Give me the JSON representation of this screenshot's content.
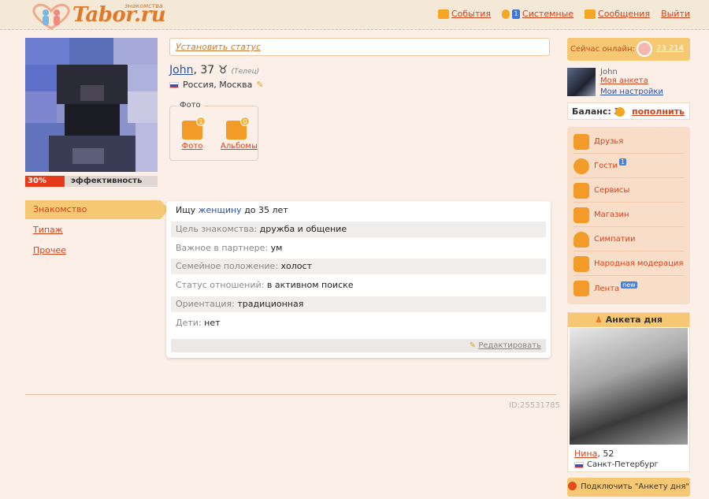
{
  "header": {
    "brand": "Tabor.ru",
    "brand_small": "знакомства",
    "nav": [
      {
        "label": "События",
        "icon": "bell-icon"
      },
      {
        "label": "Системные",
        "icon": "info-icon",
        "badge": "1"
      },
      {
        "label": "Сообщения",
        "icon": "envelope-icon"
      },
      {
        "label": "Выйти",
        "icon": ""
      }
    ]
  },
  "profile": {
    "status_placeholder": "Установить статус",
    "name": "John",
    "age": ", 37 ",
    "zodiac_symbol": "♉",
    "zodiac": "(Телец)",
    "location": "Россия, Москва",
    "effectiveness": {
      "value": 30,
      "percent_label": "30%",
      "label": "эффективность"
    },
    "photos": {
      "legend": "Фото",
      "items": [
        {
          "label": "Фото",
          "count": "1"
        },
        {
          "label": "Альбомы",
          "count": "0"
        }
      ]
    }
  },
  "tabs": [
    {
      "label": "Знакомство",
      "active": true
    },
    {
      "label": "Типаж",
      "active": false
    },
    {
      "label": "Прочее",
      "active": false
    }
  ],
  "details": {
    "seek_prefix": "Ищу ",
    "seek_highlight": "женщину",
    "seek_suffix": " до 35 лет",
    "rows": [
      {
        "key": "Цель знакомства: ",
        "value": "дружба и общение"
      },
      {
        "key": "Важное в партнере: ",
        "value": "ум"
      },
      {
        "key": "Семейное положение: ",
        "value": "холост"
      },
      {
        "key": "Статус отношений: ",
        "value": "в активном поиске"
      },
      {
        "key": "Ориентация: ",
        "value": "традиционная"
      },
      {
        "key": "Дети: ",
        "value": "нет"
      }
    ],
    "edit_label": "Редактировать"
  },
  "footer": {
    "id_label": "ID:25531785"
  },
  "sidebar": {
    "online_label": "Сейчас онлайн:",
    "online_count": "23 214",
    "user": {
      "name": "John",
      "my_profile": "Моя анкета",
      "my_settings": "Мои настройки"
    },
    "balance_label": "Баланс: 3",
    "topup_label": "пополнить",
    "menu": [
      {
        "label": "Друзья",
        "icon": "friends-icon",
        "badge": ""
      },
      {
        "label": "Гости",
        "icon": "guests-icon",
        "badge": "1"
      },
      {
        "label": "Сервисы",
        "icon": "services-icon",
        "badge": ""
      },
      {
        "label": "Магазин",
        "icon": "basket-icon",
        "badge": ""
      },
      {
        "label": "Симпатии",
        "icon": "heart-icon",
        "badge": ""
      },
      {
        "label": "Народная модерация",
        "icon": "moderation-icon",
        "badge": ""
      },
      {
        "label": "Лента",
        "icon": "feed-icon",
        "badge": "new"
      }
    ],
    "day": {
      "title": "Анкета дня",
      "name": "Нина",
      "age": ", 52",
      "city": "Санкт-Петербург"
    },
    "connect_label": "Подключить \"Анкету дня\""
  },
  "colors": {
    "accent": "#d1441b",
    "orange": "#f29b28",
    "panel": "#f7c873",
    "bg": "#fbefe8"
  }
}
